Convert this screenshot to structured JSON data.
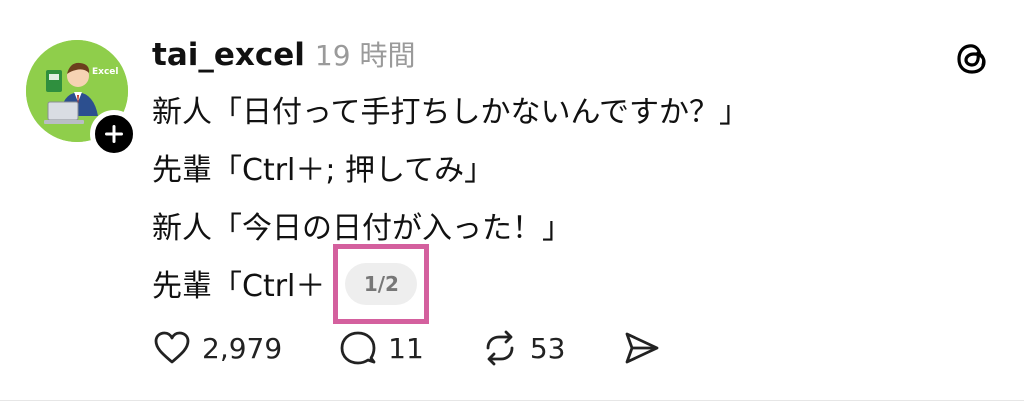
{
  "post": {
    "username": "tai_excel",
    "timestamp": "19 時間",
    "avatar_text": "Excel",
    "lines": [
      "新人「日付って手打ちしかないんですか？」",
      "先輩「Ctrl＋; 押してみ」",
      "新人「今日の日付が入った！」",
      "先輩「Ctrl＋"
    ],
    "page_indicator": "1/2"
  },
  "actions": {
    "likes": "2,979",
    "replies": "11",
    "reposts": "53"
  },
  "icons": {
    "follow": "plus-icon",
    "brand": "threads-logo-icon",
    "like": "heart-icon",
    "reply": "comment-bubble-icon",
    "repost": "repost-icon",
    "share": "send-icon"
  },
  "colors": {
    "highlight_border": "#d4609e",
    "avatar_bg": "#8fce4b",
    "muted_text": "#9a9a9a"
  }
}
